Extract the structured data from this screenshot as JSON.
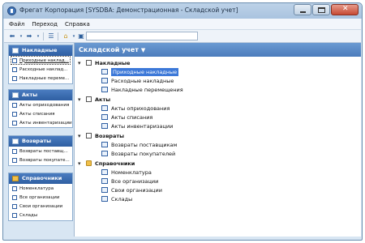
{
  "window": {
    "title": "Фрегат Корпорация [SYSDBA: Демонстрационная - Складской учет]"
  },
  "menu": [
    "Файл",
    "Переход",
    "Справка"
  ],
  "toolbar": {
    "address_value": ""
  },
  "sidebar": {
    "groups": [
      {
        "title": "Накладные",
        "items": [
          "Приходные наклад...",
          "Расходные наклад...",
          "Накладные переме..."
        ]
      },
      {
        "title": "Акты",
        "items": [
          "Акты оприходования",
          "Акты списания",
          "Акты инвентаризации"
        ]
      },
      {
        "title": "Возвраты",
        "items": [
          "Возвраты поставщ...",
          "Возвраты покупате..."
        ]
      },
      {
        "title": "Справочники",
        "items": [
          "Номенклатура",
          "Все организации",
          "Свои организации",
          "Склады"
        ]
      }
    ]
  },
  "main": {
    "title": "Складской учет",
    "sections": [
      {
        "title": "Накладные",
        "items": [
          "Приходные накладные",
          "Расходные накладные",
          "Накладные перемещения"
        ]
      },
      {
        "title": "Акты",
        "items": [
          "Акты оприходования",
          "Акты списания",
          "Акты инвентаризации"
        ]
      },
      {
        "title": "Возвраты",
        "items": [
          "Возвраты поставщикам",
          "Возвраты покупателей"
        ]
      },
      {
        "title": "Справочники",
        "items": [
          "Номенклатура",
          "Все организации",
          "Свои организации",
          "Склады"
        ]
      }
    ]
  }
}
